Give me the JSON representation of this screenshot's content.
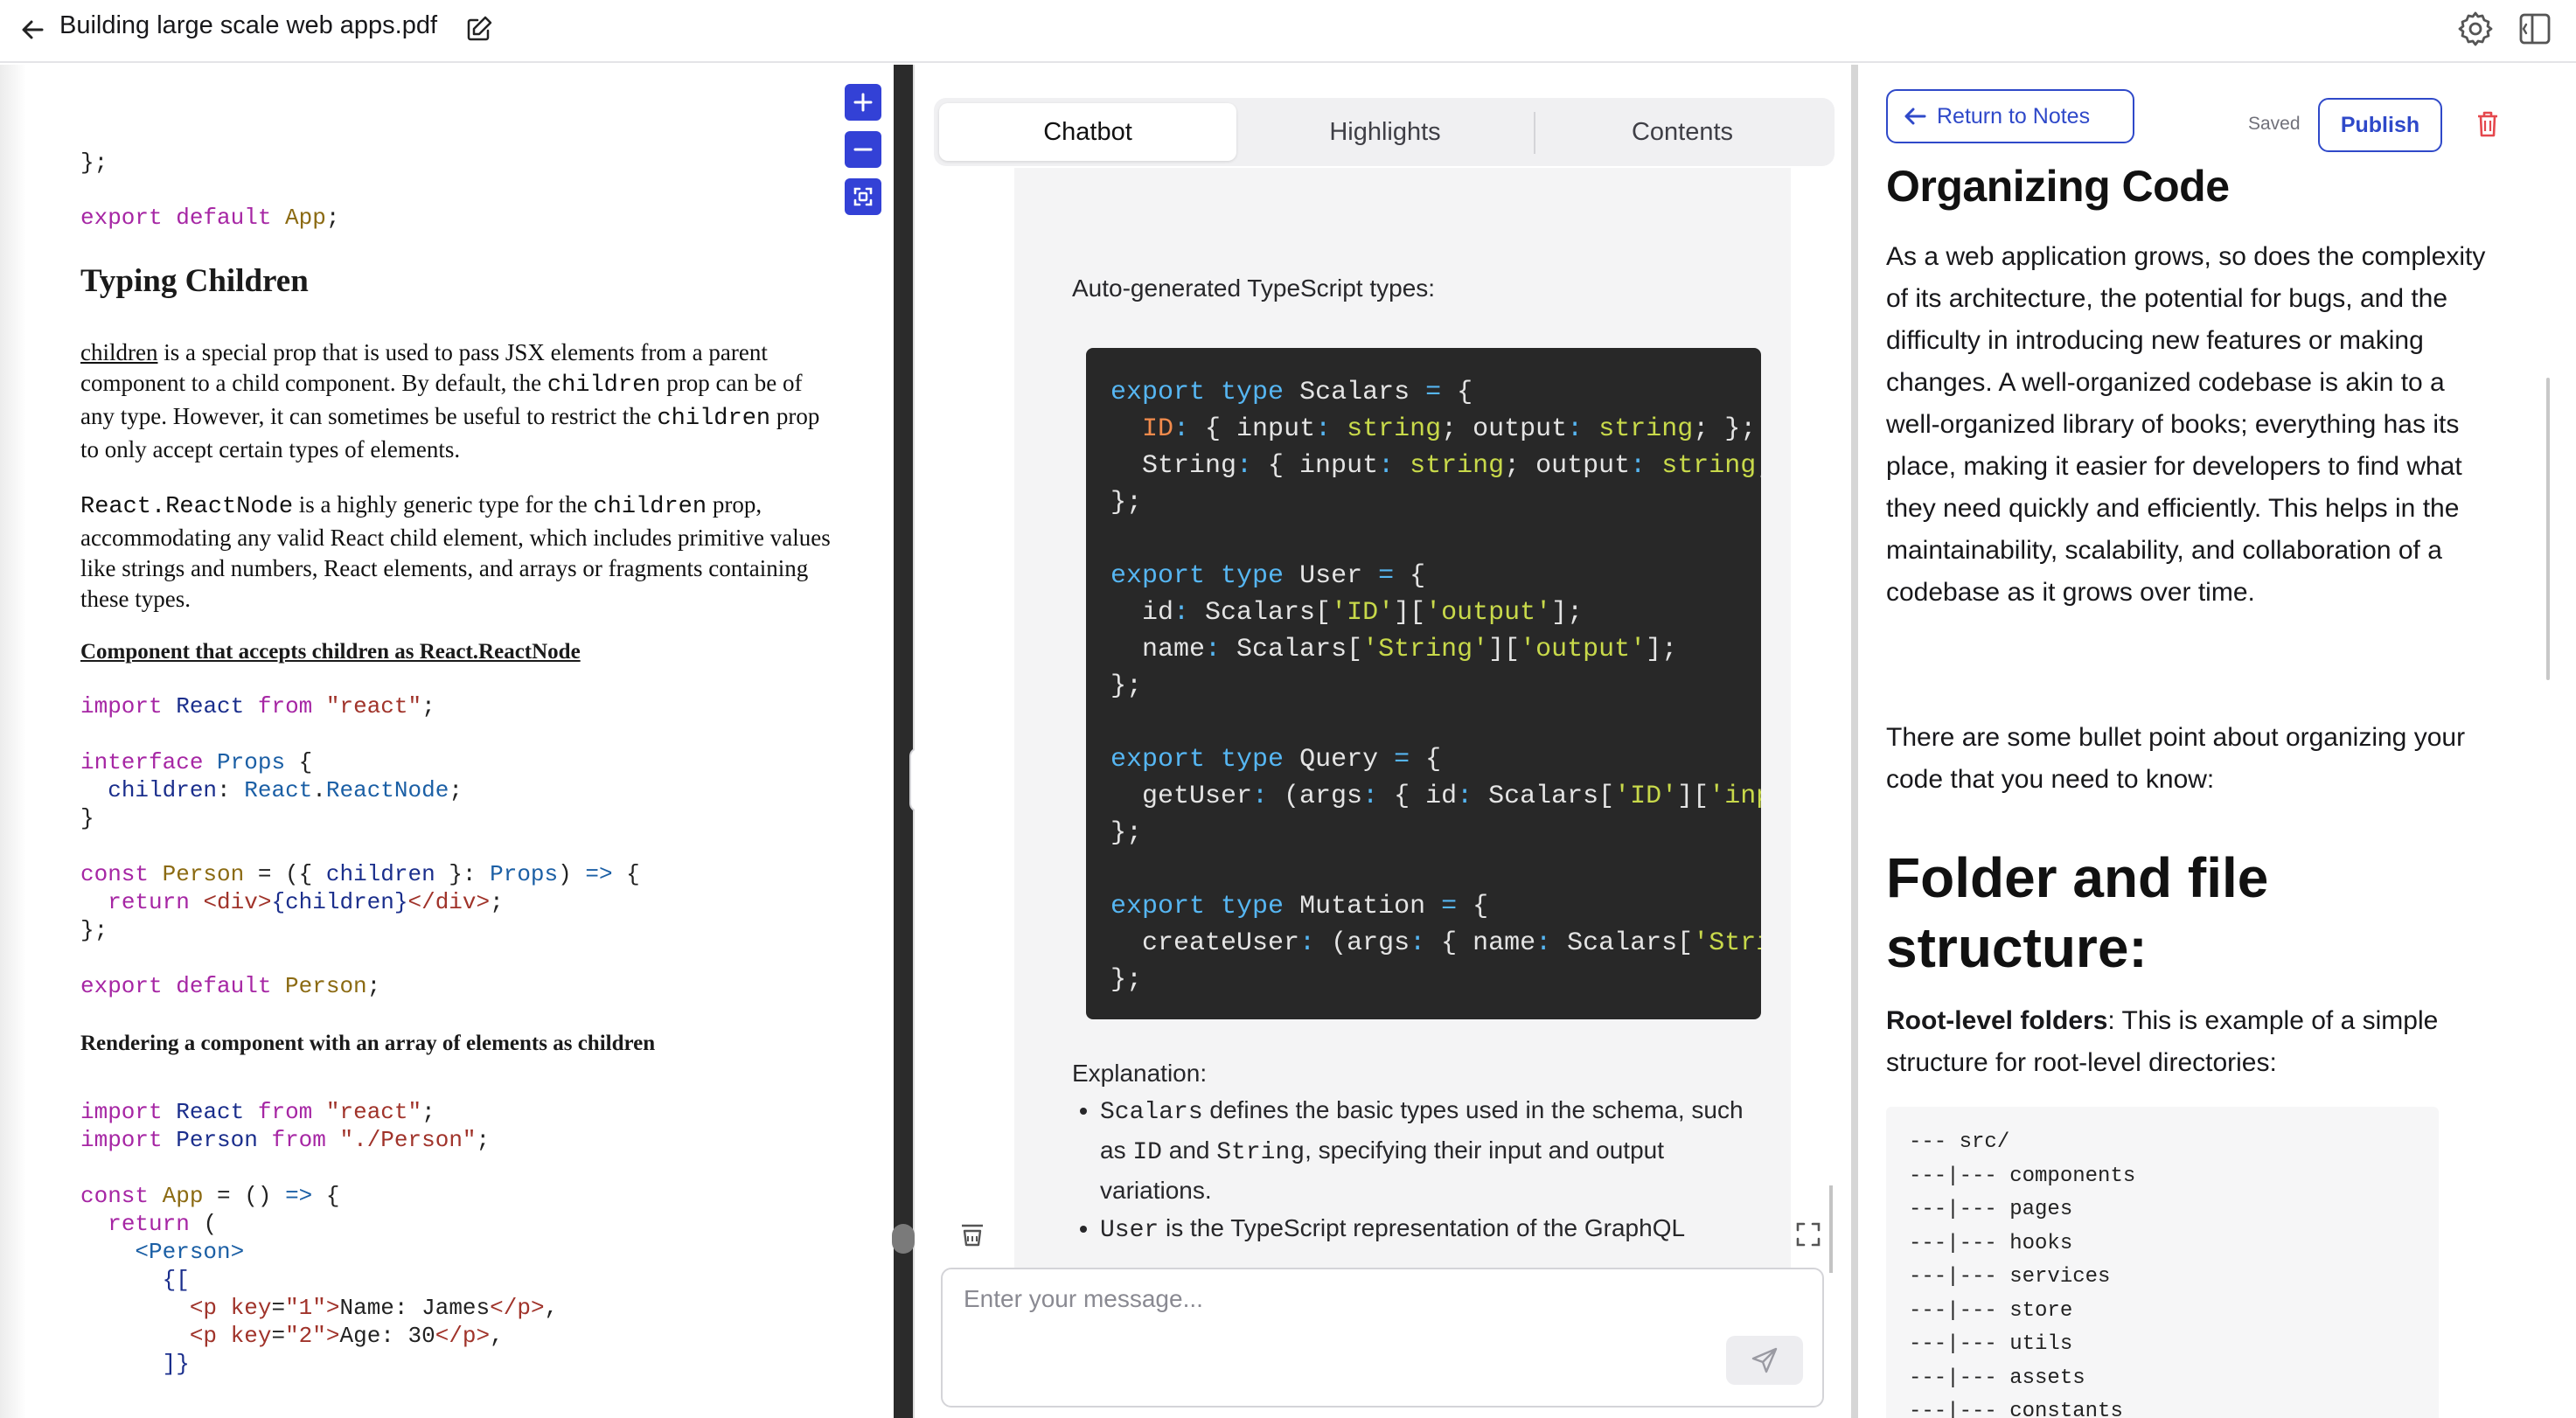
{
  "header": {
    "file_title": "Building large scale web apps.pdf"
  },
  "pdf": {
    "zoom_in": "+",
    "zoom_out": "−",
    "heading_typing_children": "Typing Children",
    "p1": {
      "link": "children",
      "text1": " is a special prop that is used to pass JSX elements from a parent component to a child component. By default, the ",
      "code1": "children",
      "text2": " prop can be of any type. However, it can sometimes be useful to restrict the ",
      "code2": "children",
      "text3": " prop to only accept certain types of elements."
    },
    "p2": {
      "code1": "React.ReactNode",
      "text1": " is a highly generic type for the ",
      "code2": "children",
      "text2": " prop, accommodating any valid React child element, which includes primitive values like strings and numbers, React elements, and arrays or fragments containing these types."
    },
    "subheading_reactnode": "Component that accepts children as React.ReactNode",
    "subheading_array": "Rendering a component with an array of elements as children"
  },
  "chat": {
    "tabs": [
      "Chatbot",
      "Highlights",
      "Contents"
    ],
    "intro": "Auto-generated TypeScript types:",
    "explanation_label": "Explanation:",
    "bullet1": {
      "code1": "Scalars",
      "text1": " defines the basic types used in the schema, such as ",
      "code2": "ID",
      "text2": " and ",
      "code3": "String",
      "text3": ", specifying their input and output variations."
    },
    "bullet2": {
      "code1": "User",
      "text1": " is the TypeScript representation of the GraphQL"
    },
    "input_placeholder": "Enter your message..."
  },
  "notes": {
    "return_label": "Return to Notes",
    "saved_label": "Saved",
    "publish_label": "Publish",
    "title": "Organizing Code",
    "p1": "As a web application grows, so does the complexity of its architecture, the potential for bugs, and the difficulty in introducing new features or making changes. A well-organized codebase is akin to a well-organized library of books; everything has its place, making it easier for developers to find what they need quickly and efficiently. This helps in the maintainability, scalability, and collaboration of a codebase as it grows over time.",
    "p2": "There are some bullet point about organizing your code that you need to know:",
    "h2": "Folder and file structure:",
    "p3_bold": "Root-level folders",
    "p3_rest": ": This is example of a simple structure for root-level directories:",
    "tree": [
      "--- src/",
      "---|--- components",
      "---|--- pages",
      "---|--- hooks",
      "---|--- services",
      "---|--- store",
      "---|--- utils",
      "---|--- assets",
      "---|--- constants"
    ]
  },
  "icons": {
    "back": "arrow-left-icon",
    "edit": "edit-icon",
    "settings": "gear-icon",
    "panel": "sidebar-toggle-icon",
    "zoom_in": "plus-icon",
    "zoom_out": "minus-icon",
    "fit": "fit-screen-icon",
    "clear": "broom-icon",
    "expand": "expand-icon",
    "send": "send-icon",
    "delete": "trash-icon"
  },
  "colors": {
    "accent": "#3341d6",
    "notes_accent": "#2f49c9",
    "delete": "#e5484d",
    "code_bg": "#282828"
  }
}
